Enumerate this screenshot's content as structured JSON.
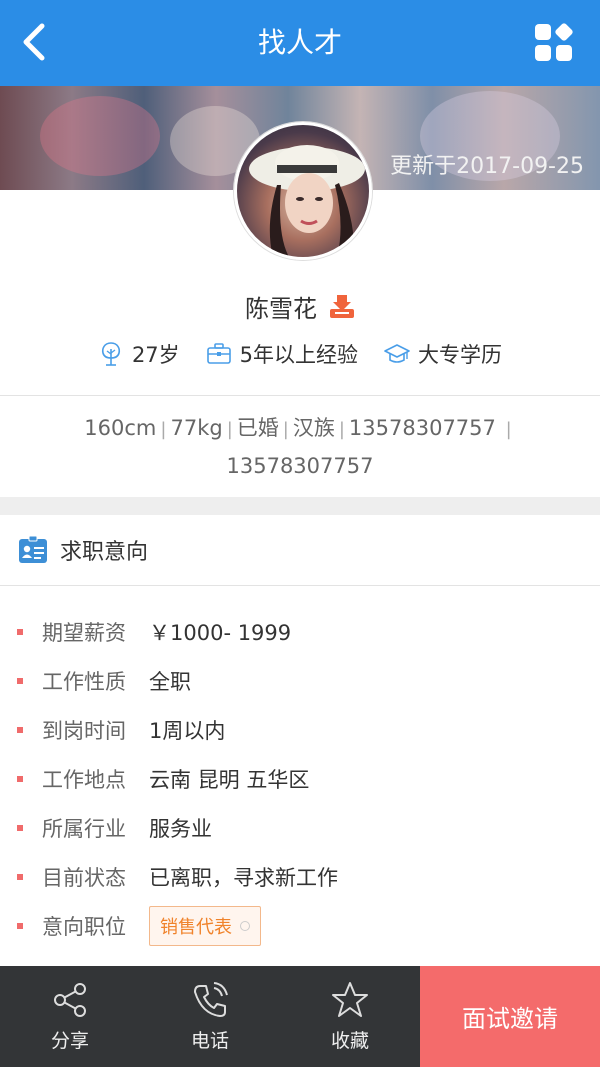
{
  "header": {
    "title": "找人才",
    "back_icon": "chevron-left-icon",
    "menu_icon": "grid-icon",
    "color": "#2b8de6"
  },
  "profile": {
    "updated": "更新于2017-09-25",
    "name": "陈雪花",
    "age": "27岁",
    "experience": "5年以上经验",
    "education": "大专学历",
    "height": "160cm",
    "weight": "77kg",
    "marital": "已婚",
    "ethnicity": "汉族",
    "phone1": "13578307757",
    "phone2": "13578307757"
  },
  "section": {
    "title": "求职意向",
    "icon": "id-card-icon"
  },
  "intent": {
    "rows": [
      {
        "key": "期望薪资",
        "value": "￥1000- 1999"
      },
      {
        "key": "工作性质",
        "value": "全职"
      },
      {
        "key": "到岗时间",
        "value": "1周以内"
      },
      {
        "key": "工作地点",
        "value": "云南 昆明 五华区"
      },
      {
        "key": "所属行业",
        "value": "服务业"
      },
      {
        "key": "目前状态",
        "value": "已离职，寻求新工作"
      }
    ],
    "position_key": "意向职位",
    "position_tag": "销售代表"
  },
  "bottom": {
    "share": "分享",
    "phone": "电话",
    "favorite": "收藏",
    "invite": "面试邀请",
    "invite_color": "#f46b6b"
  }
}
